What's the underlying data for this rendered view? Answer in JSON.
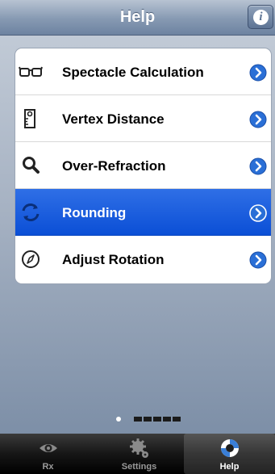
{
  "navbar": {
    "title": "Help",
    "info_icon_glyph": "i"
  },
  "menu": {
    "items": [
      {
        "label": "Spectacle Calculation",
        "icon": "glasses-icon",
        "selected": false
      },
      {
        "label": "Vertex Distance",
        "icon": "vertex-ruler-icon",
        "selected": false
      },
      {
        "label": "Over-Refraction",
        "icon": "magnifier-icon",
        "selected": false
      },
      {
        "label": "Rounding",
        "icon": "rotate-arrows-icon",
        "selected": true
      },
      {
        "label": "Adjust Rotation",
        "icon": "compass-icon",
        "selected": false
      }
    ]
  },
  "pager": {
    "pages": 6,
    "current": 1
  },
  "tabbar": {
    "tabs": [
      {
        "label": "Rx",
        "icon": "eye-icon",
        "active": false
      },
      {
        "label": "Settings",
        "icon": "gears-icon",
        "active": false
      },
      {
        "label": "Help",
        "icon": "lifebuoy-icon",
        "active": true
      }
    ]
  },
  "colors": {
    "selection_blue": "#1a5ee0",
    "disclosure_blue": "#2a6fd6",
    "navbar_blue_gray": "#8699b2"
  }
}
